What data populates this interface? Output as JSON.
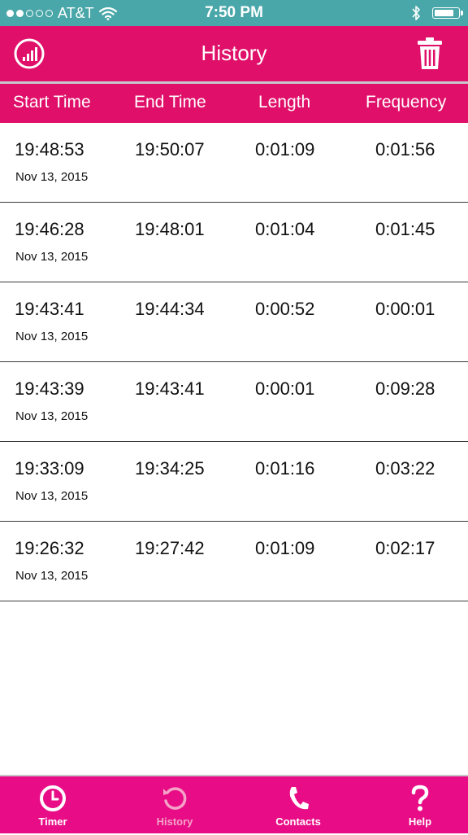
{
  "status_bar": {
    "carrier": "AT&T",
    "time": "7:50 PM",
    "signal_bars": 2,
    "signal_total": 5,
    "battery_level": 0.9
  },
  "header": {
    "title": "History",
    "left_icon": "stats-chart-icon",
    "right_icon": "trash-icon"
  },
  "columns": {
    "start": "Start Time",
    "end": "End Time",
    "length": "Length",
    "frequency": "Frequency"
  },
  "rows": [
    {
      "start": "19:48:53",
      "date": "Nov 13, 2015",
      "end": "19:50:07",
      "length": "0:01:09",
      "frequency": "0:01:56"
    },
    {
      "start": "19:46:28",
      "date": "Nov 13, 2015",
      "end": "19:48:01",
      "length": "0:01:04",
      "frequency": "0:01:45"
    },
    {
      "start": "19:43:41",
      "date": "Nov 13, 2015",
      "end": "19:44:34",
      "length": "0:00:52",
      "frequency": "0:00:01"
    },
    {
      "start": "19:43:39",
      "date": "Nov 13, 2015",
      "end": "19:43:41",
      "length": "0:00:01",
      "frequency": "0:09:28"
    },
    {
      "start": "19:33:09",
      "date": "Nov 13, 2015",
      "end": "19:34:25",
      "length": "0:01:16",
      "frequency": "0:03:22"
    },
    {
      "start": "19:26:32",
      "date": "Nov 13, 2015",
      "end": "19:27:42",
      "length": "0:01:09",
      "frequency": "0:02:17"
    }
  ],
  "tabs": [
    {
      "label": "Timer",
      "icon": "clock-icon",
      "active": false
    },
    {
      "label": "History",
      "icon": "history-icon",
      "active": true
    },
    {
      "label": "Contacts",
      "icon": "phone-icon",
      "active": false
    },
    {
      "label": "Help",
      "icon": "question-icon",
      "active": false
    }
  ],
  "colors": {
    "status_bar": "#4aa7a9",
    "accent": "#e0106a",
    "tab_bar": "#e80d86",
    "active_tab": "#f4a3c8"
  }
}
